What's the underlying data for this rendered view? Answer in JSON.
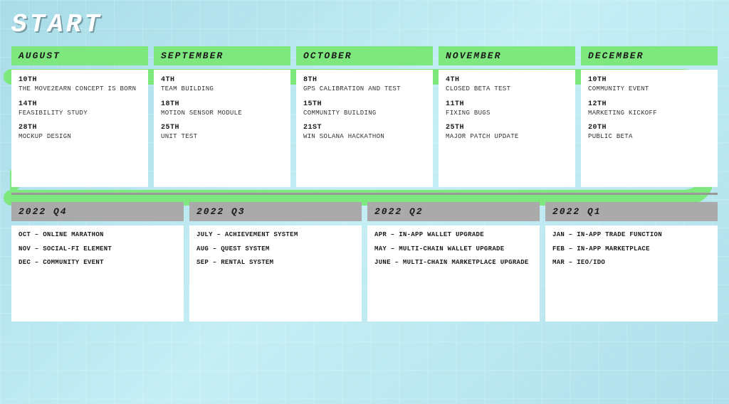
{
  "title": "START",
  "colors": {
    "green": "#7ee87e",
    "gray": "#aaaaaa",
    "white": "#ffffff",
    "dark": "#1a1a1a"
  },
  "top_section": {
    "months": [
      {
        "name": "AUGUST",
        "events": [
          {
            "date": "10TH",
            "desc": "THE MOVE2EARN CONCEPT IS BORN"
          },
          {
            "date": "14TH",
            "desc": "FEASIBILITY STUDY"
          },
          {
            "date": "28TH",
            "desc": "MOCKUP DESIGN"
          }
        ]
      },
      {
        "name": "SEPTEMBER",
        "events": [
          {
            "date": "4TH",
            "desc": "TEAM BUILDING"
          },
          {
            "date": "18TH",
            "desc": "MOTION SENSOR MODULE"
          },
          {
            "date": "25TH",
            "desc": "UNIT TEST"
          }
        ]
      },
      {
        "name": "OCTOBER",
        "events": [
          {
            "date": "8TH",
            "desc": "GPS CALIBRATION AND TEST"
          },
          {
            "date": "15TH",
            "desc": "COMMUNITY BUILDING"
          },
          {
            "date": "21ST",
            "desc": "WIN SOLANA HACKATHON"
          }
        ]
      },
      {
        "name": "NOVEMBER",
        "events": [
          {
            "date": "4TH",
            "desc": "CLOSED BETA TEST"
          },
          {
            "date": "11TH",
            "desc": "FIXING BUGS"
          },
          {
            "date": "25TH",
            "desc": "MAJOR PATCH UPDATE"
          }
        ]
      },
      {
        "name": "DECEMBER",
        "events": [
          {
            "date": "10TH",
            "desc": "COMMUNITY EVENT"
          },
          {
            "date": "12TH",
            "desc": "MARKETING KICKOFF"
          },
          {
            "date": "20TH",
            "desc": "PUBLIC BETA"
          }
        ]
      }
    ]
  },
  "bottom_section": {
    "quarters": [
      {
        "name": "2022 Q4",
        "events": [
          {
            "desc": "OCT – ONLINE MARATHON"
          },
          {
            "desc": "NOV – SOCIAL-FI ELEMENT"
          },
          {
            "desc": "DEC – COMMUNITY EVENT"
          }
        ]
      },
      {
        "name": "2022 Q3",
        "events": [
          {
            "desc": "JULY – ACHIEVEMENT SYSTEM"
          },
          {
            "desc": "AUG – QUEST SYSTEM"
          },
          {
            "desc": "SEP – RENTAL SYSTEM"
          }
        ]
      },
      {
        "name": "2022 Q2",
        "events": [
          {
            "desc": "APR – IN-APP WALLET UPGRADE"
          },
          {
            "desc": "MAY – MULTI-CHAIN WALLET UPGRADE"
          },
          {
            "desc": "JUNE – MULTI-CHAIN MARKETPLACE UPGRADE"
          }
        ]
      },
      {
        "name": "2022 Q1",
        "events": [
          {
            "desc": "JAN – IN-APP TRADE FUNCTION"
          },
          {
            "desc": "FEB – IN-APP MARKETPLACE"
          },
          {
            "desc": "MAR – IEO/IDO"
          }
        ]
      }
    ]
  }
}
